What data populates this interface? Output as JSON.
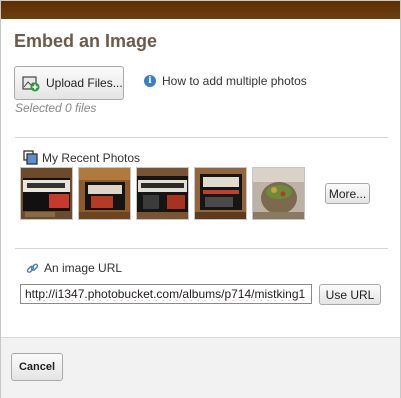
{
  "dialog": {
    "title": "Embed an Image"
  },
  "upload": {
    "button_label": "Upload Files...",
    "help_link": "How to add multiple photos",
    "selected_text": "Selected 0 files"
  },
  "recent": {
    "label": "My Recent Photos",
    "more_label": "More...",
    "thumbnails": [
      {
        "icon": "photo-bates-motel-1"
      },
      {
        "icon": "photo-bates-motel-2"
      },
      {
        "icon": "photo-bates-motel-3"
      },
      {
        "icon": "photo-bates-motel-4"
      },
      {
        "icon": "photo-jar"
      }
    ]
  },
  "url": {
    "label": "An image URL",
    "value": "http://i1347.photobucket.com/albums/p714/mistking1",
    "button_label": "Use URL"
  },
  "footer": {
    "cancel_label": "Cancel"
  },
  "colors": {
    "top_bar": "#5a2f05",
    "title": "#6b5b4b",
    "info_icon": "#3a7fc6",
    "link_icon": "#4a7fb5"
  }
}
